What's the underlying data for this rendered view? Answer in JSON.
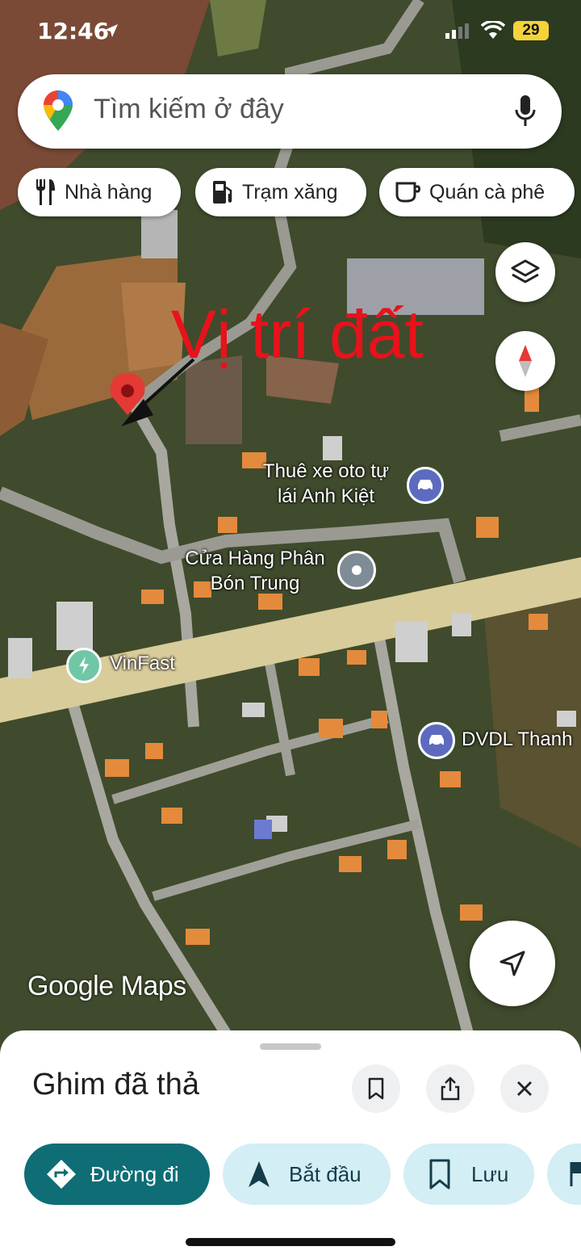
{
  "status_bar": {
    "time": "12:46",
    "battery": "29"
  },
  "search": {
    "placeholder": "Tìm kiếm ở đây"
  },
  "chips": [
    {
      "label": "Nhà hàng",
      "icon": "restaurant-icon"
    },
    {
      "label": "Trạm xăng",
      "icon": "gas-station-icon"
    },
    {
      "label": "Quán cà phê",
      "icon": "coffee-icon"
    }
  ],
  "annotation": {
    "text": "Vị trí đất"
  },
  "places": [
    {
      "label": "Thuê xe oto tự\nlái Anh Kiệt",
      "icon": "car-rental-icon"
    },
    {
      "label": "Cửa Hàng Phân\nBón Trung",
      "icon": "place-icon"
    },
    {
      "label": "VinFast",
      "icon": "ev-charging-icon"
    },
    {
      "label": "DVDL Thanh",
      "icon": "car-rental-icon"
    }
  ],
  "watermark": {
    "text": "Google Maps"
  },
  "sheet": {
    "title": "Ghim đã thả",
    "actions": [
      {
        "label": "Đường đi",
        "icon": "directions-icon"
      },
      {
        "label": "Bắt đầu",
        "icon": "navigation-arrow-icon"
      },
      {
        "label": "Lưu",
        "icon": "bookmark-icon"
      }
    ]
  },
  "colors": {
    "accent": "#0e6d75",
    "tonal": "#d3eef4",
    "annotation": "#e8121b",
    "pin": "#e53935"
  }
}
